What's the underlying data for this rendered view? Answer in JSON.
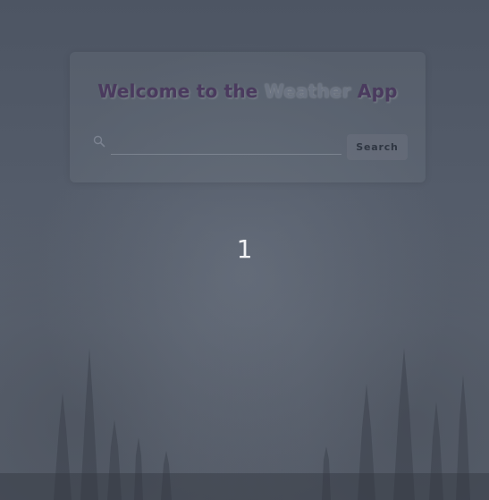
{
  "app": {
    "title_prefix": "Welcome to the ",
    "title_accent": "Weather",
    "title_suffix": " App"
  },
  "search": {
    "icon": "search-icon",
    "value": "",
    "placeholder": "",
    "button_label": "Search"
  },
  "result": {
    "value": "1"
  },
  "colors": {
    "background": "#535b69",
    "title": "#4a3a5e",
    "title_accent": "#6c7482",
    "result_text": "#f2f3f5"
  }
}
